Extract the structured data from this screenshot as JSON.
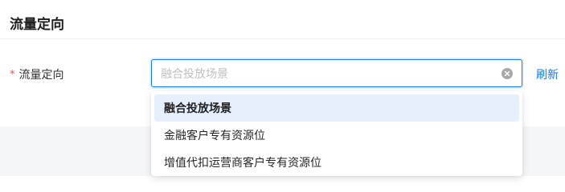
{
  "section": {
    "title": "流量定向"
  },
  "form": {
    "label": "流量定向",
    "required_mark": "*",
    "select": {
      "placeholder": "融合投放场景",
      "options": [
        {
          "label": "融合投放场景",
          "selected": true
        },
        {
          "label": "金融客户专有资源位",
          "selected": false
        },
        {
          "label": "增值代扣运营商客户专有资源位",
          "selected": false
        }
      ]
    },
    "refresh_label": "刷新"
  },
  "colors": {
    "accent": "#1677ff",
    "required": "#ff4d4f",
    "selected_option_bg": "#e6f0fd"
  }
}
